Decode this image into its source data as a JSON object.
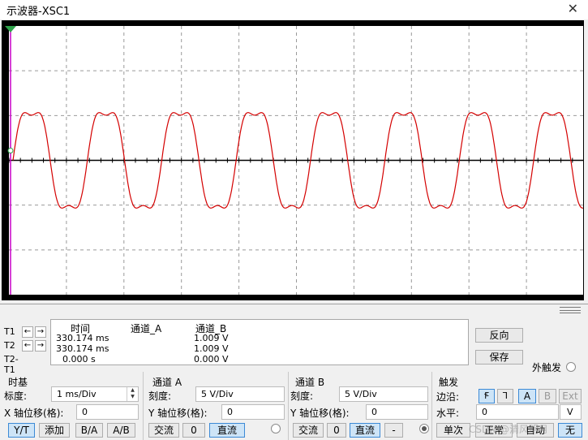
{
  "window": {
    "title": "示波器-XSC1",
    "close_glyph": "✕"
  },
  "screen": {
    "background": "#000000",
    "grid_color": "#9a9a9a",
    "trace_color": "#d40000",
    "cursor_t1_color": "#c800c8",
    "axis_color": "#000000"
  },
  "chart_data": {
    "type": "line",
    "title": "",
    "xlabel": "",
    "ylabel": "",
    "xlim": [
      0,
      10
    ],
    "ylim": [
      -20,
      20
    ],
    "grid": true,
    "series": [
      {
        "channel": "A",
        "cycles": 8,
        "period_ms": 1.32,
        "amplitude_v": 8.2,
        "end_ms": 11.3
      }
    ]
  },
  "cursors": {
    "t1": {
      "label": "T1",
      "left_arrow": "←",
      "right_arrow": "→"
    },
    "t2": {
      "label": "T2",
      "left_arrow": "←",
      "right_arrow": "→"
    },
    "diff": {
      "label": "T2-T1"
    }
  },
  "readout": {
    "col_time": "时间",
    "col_a": "通道_A",
    "col_b": "通道_B",
    "t1_time": "330.174 ms",
    "t1_b": "1.009 V",
    "t2_time": "330.174 ms",
    "t2_b": "1.009 V",
    "diff_time": "0.000 s",
    "diff_b": "0.000 V"
  },
  "actions": {
    "reverse": "反向",
    "save": "保存",
    "ext_trigger": "外触发"
  },
  "timebase": {
    "title": "时基",
    "scale_label": "标度:",
    "scale_value": "1 ms/Div",
    "xpos_label": "X 轴位移(格):",
    "xpos_value": "0",
    "modes": [
      "Y/T",
      "添加",
      "B/A",
      "A/B"
    ]
  },
  "channel_a": {
    "title": "通道 A",
    "scale_label": "刻度:",
    "scale_value": "5  V/Div",
    "ypos_label": "Y 轴位移(格):",
    "ypos_value": "0",
    "coupling": [
      "交流",
      "0",
      "直流"
    ]
  },
  "channel_b": {
    "title": "通道 B",
    "scale_label": "刻度:",
    "scale_value": "5  V/Div",
    "ypos_label": "Y 轴位移(格):",
    "ypos_value": "0",
    "coupling": [
      "交流",
      "0",
      "直流",
      "-"
    ]
  },
  "trigger": {
    "title": "触发",
    "edge_label": "边沿:",
    "edge_rise": "Ꞙ",
    "edge_fall": "Ꞁ",
    "sources": [
      "A",
      "B",
      "Ext"
    ],
    "level_label": "水平:",
    "level_value": "0",
    "level_unit": "V",
    "modes": [
      "单次",
      "正常",
      "自动",
      "无"
    ]
  },
  "watermark": "CSDN @清风明月"
}
